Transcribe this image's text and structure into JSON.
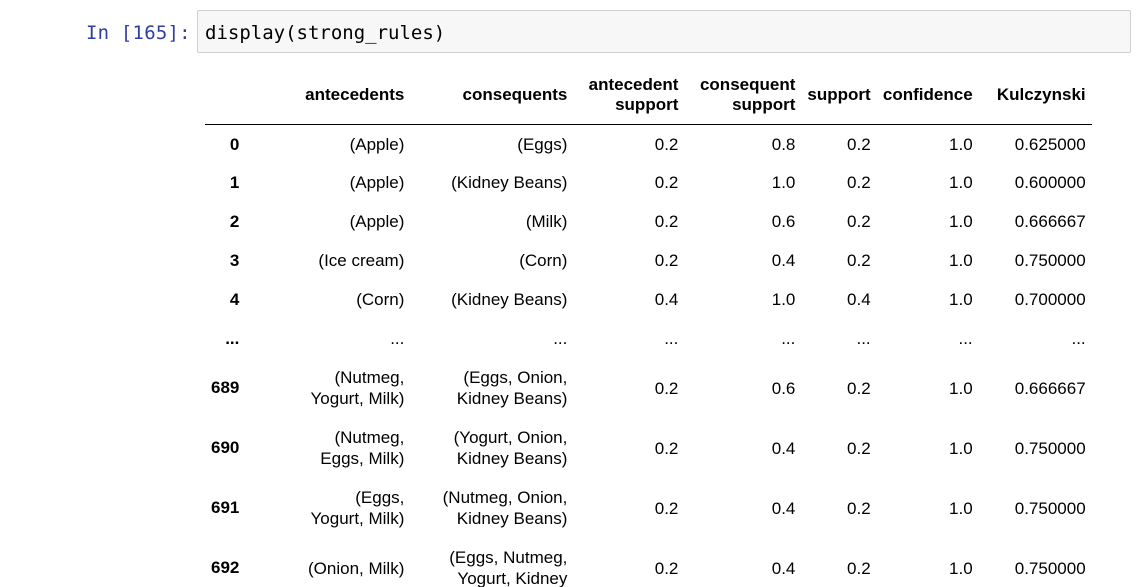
{
  "cell": {
    "prompt": "In [165]:",
    "code": "display(strong_rules)"
  },
  "table": {
    "columns": [
      {
        "line1": "",
        "line2": ""
      },
      {
        "line1": "antecedents",
        "line2": ""
      },
      {
        "line1": "consequents",
        "line2": ""
      },
      {
        "line1": "antecedent",
        "line2": "support"
      },
      {
        "line1": "consequent",
        "line2": "support"
      },
      {
        "line1": "support",
        "line2": ""
      },
      {
        "line1": "confidence",
        "line2": ""
      },
      {
        "line1": "Kulczynski",
        "line2": ""
      }
    ],
    "rows": [
      {
        "index": "0",
        "antecedents": [
          "(Apple)"
        ],
        "consequents": [
          "(Eggs)"
        ],
        "antecedent_support": "0.2",
        "consequent_support": "0.8",
        "support": "0.2",
        "confidence": "1.0",
        "kulczynski": "0.625000"
      },
      {
        "index": "1",
        "antecedents": [
          "(Apple)"
        ],
        "consequents": [
          "(Kidney Beans)"
        ],
        "antecedent_support": "0.2",
        "consequent_support": "1.0",
        "support": "0.2",
        "confidence": "1.0",
        "kulczynski": "0.600000"
      },
      {
        "index": "2",
        "antecedents": [
          "(Apple)"
        ],
        "consequents": [
          "(Milk)"
        ],
        "antecedent_support": "0.2",
        "consequent_support": "0.6",
        "support": "0.2",
        "confidence": "1.0",
        "kulczynski": "0.666667"
      },
      {
        "index": "3",
        "antecedents": [
          "(Ice cream)"
        ],
        "consequents": [
          "(Corn)"
        ],
        "antecedent_support": "0.2",
        "consequent_support": "0.4",
        "support": "0.2",
        "confidence": "1.0",
        "kulczynski": "0.750000"
      },
      {
        "index": "4",
        "antecedents": [
          "(Corn)"
        ],
        "consequents": [
          "(Kidney Beans)"
        ],
        "antecedent_support": "0.4",
        "consequent_support": "1.0",
        "support": "0.4",
        "confidence": "1.0",
        "kulczynski": "0.700000"
      },
      {
        "index": "...",
        "antecedents": [
          "..."
        ],
        "consequents": [
          "..."
        ],
        "antecedent_support": "...",
        "consequent_support": "...",
        "support": "...",
        "confidence": "...",
        "kulczynski": "..."
      },
      {
        "index": "689",
        "antecedents": [
          "(Nutmeg,",
          "Yogurt, Milk)"
        ],
        "consequents": [
          "(Eggs, Onion,",
          "Kidney Beans)"
        ],
        "antecedent_support": "0.2",
        "consequent_support": "0.6",
        "support": "0.2",
        "confidence": "1.0",
        "kulczynski": "0.666667"
      },
      {
        "index": "690",
        "antecedents": [
          "(Nutmeg,",
          "Eggs, Milk)"
        ],
        "consequents": [
          "(Yogurt, Onion,",
          "Kidney Beans)"
        ],
        "antecedent_support": "0.2",
        "consequent_support": "0.4",
        "support": "0.2",
        "confidence": "1.0",
        "kulczynski": "0.750000"
      },
      {
        "index": "691",
        "antecedents": [
          "(Eggs,",
          "Yogurt, Milk)"
        ],
        "consequents": [
          "(Nutmeg, Onion,",
          "Kidney Beans)"
        ],
        "antecedent_support": "0.2",
        "consequent_support": "0.4",
        "support": "0.2",
        "confidence": "1.0",
        "kulczynski": "0.750000"
      },
      {
        "index": "692",
        "antecedents": [
          "(Onion, Milk)"
        ],
        "consequents": [
          "(Eggs, Nutmeg,",
          "Yogurt, Kidney"
        ],
        "antecedent_support": "0.2",
        "consequent_support": "0.4",
        "support": "0.2",
        "confidence": "1.0",
        "kulczynski": "0.750000"
      }
    ]
  }
}
